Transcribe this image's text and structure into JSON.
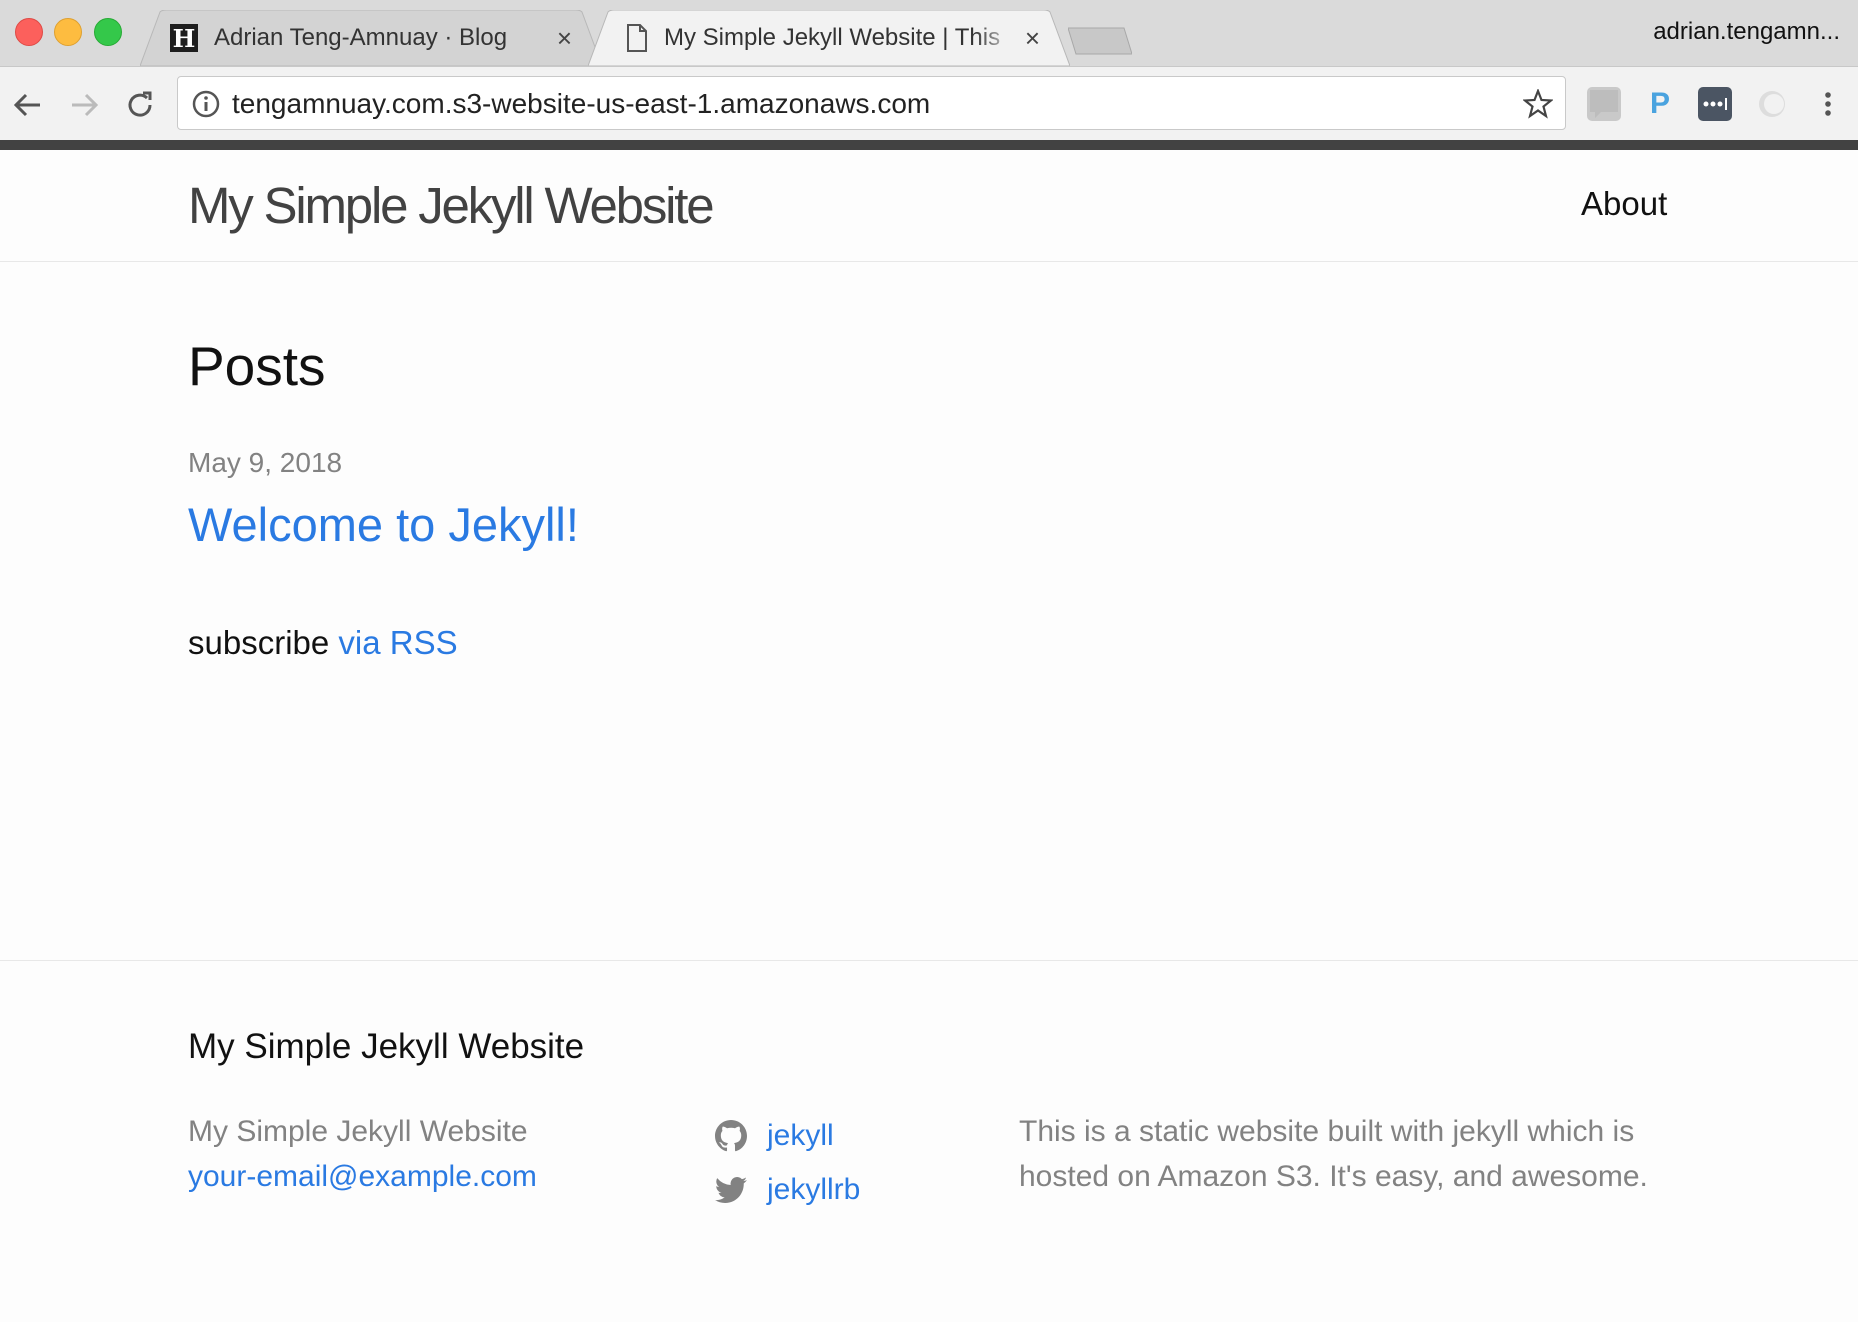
{
  "browser": {
    "tabs": [
      {
        "title": "Adrian Teng-Amnuay · Blog",
        "favicon": "H",
        "close": "×"
      },
      {
        "title": "My Simple Jekyll Website | This",
        "close": "×"
      }
    ],
    "profile_name": "adrian.tengamn...",
    "address": "tengamnuay.com.s3-website-us-east-1.amazonaws.com",
    "extensions": [
      "walkme-icon",
      "p-icon",
      "password-manager-icon",
      "opera-like-icon",
      "menu-icon"
    ]
  },
  "header": {
    "site_title": "My Simple Jekyll Website",
    "nav": {
      "about": "About"
    }
  },
  "main": {
    "heading": "Posts",
    "posts": [
      {
        "date": "May 9, 2018",
        "title": "Welcome to Jekyll!"
      }
    ],
    "subscribe_text": "subscribe",
    "subscribe_link": "via RSS"
  },
  "footer": {
    "heading": "My Simple Jekyll Website",
    "site_name": "My Simple Jekyll Website",
    "email": "your-email@example.com",
    "github": "jekyll",
    "twitter": "jekyllrb",
    "description": "This is a static website built with jekyll which is hosted on Amazon S3. It's easy, and awesome."
  },
  "colors": {
    "link": "#2a7ae2",
    "muted": "#828282",
    "text": "#111111"
  }
}
